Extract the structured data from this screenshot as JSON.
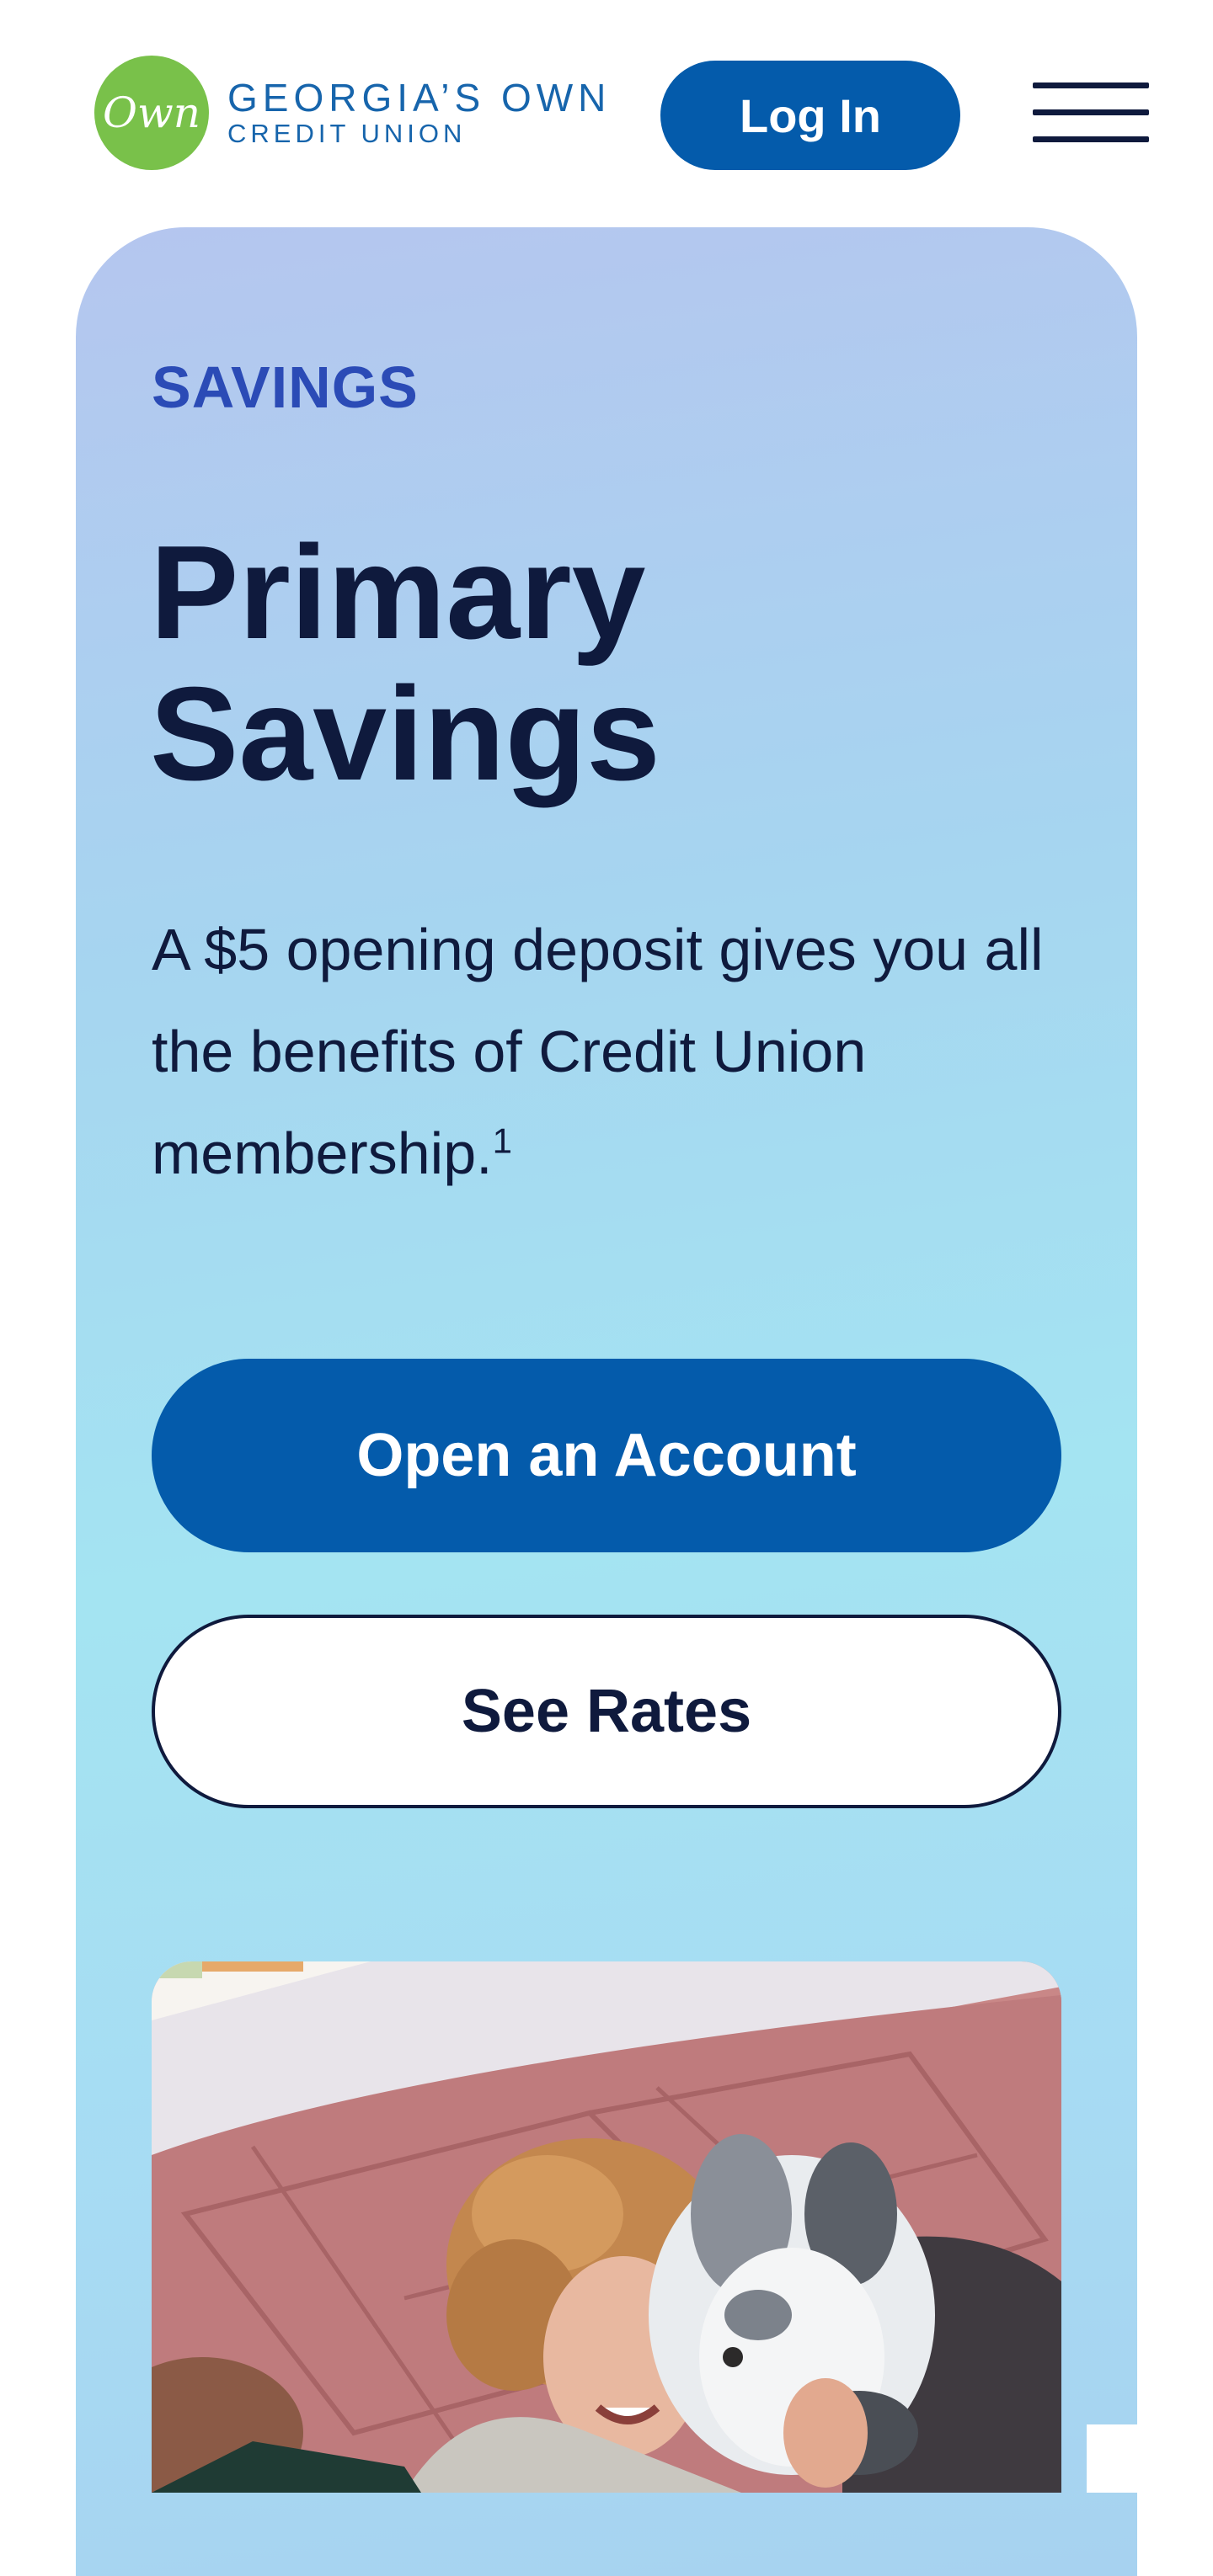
{
  "header": {
    "logo": {
      "mark_text": "Own",
      "line1": "GEORGIA’S OWN",
      "line2": "CREDIT UNION"
    },
    "login_label": "Log In",
    "menu_icon": "hamburger-menu-icon"
  },
  "hero": {
    "eyebrow": "SAVINGS",
    "title": "Primary Savings",
    "description": "A $5 opening deposit gives you all the benefits of Credit Union membership.",
    "footnote": "1",
    "primary_cta": "Open an Account",
    "secondary_cta": "See Rates",
    "photo": "woman-hugging-dog-photo"
  },
  "colors": {
    "brand_blue": "#045bab",
    "navy_text": "#0f1a3d",
    "eyebrow_blue": "#2b4bb6",
    "logo_green": "#79c14a",
    "logo_blue": "#1765ac",
    "gradient_top": "#b5c6ef",
    "gradient_mid": "#a4e4f2"
  }
}
